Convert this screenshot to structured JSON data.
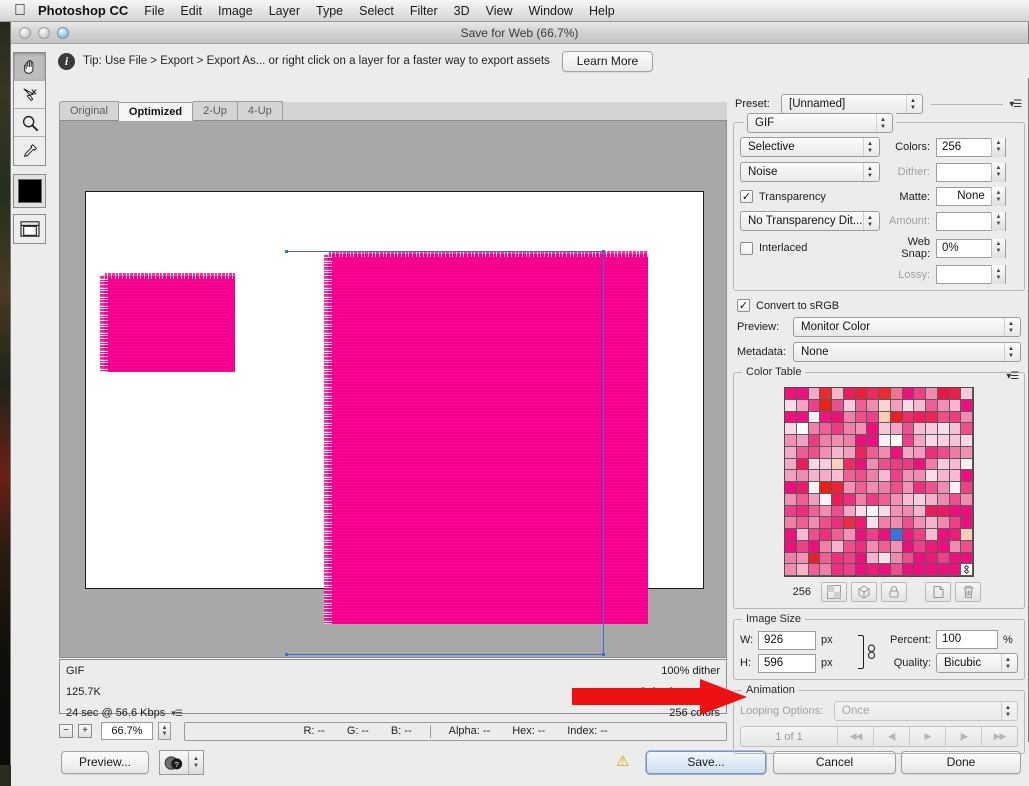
{
  "menubar": {
    "apple_icon": "apple-logo",
    "app_name": "Photoshop CC",
    "items": [
      "File",
      "Edit",
      "Image",
      "Layer",
      "Type",
      "Select",
      "Filter",
      "3D",
      "View",
      "Window",
      "Help"
    ]
  },
  "window": {
    "title": "Save for Web (66.7%)"
  },
  "tip": {
    "icon": "info-icon",
    "text": "Tip: Use File > Export > Export As...  or right click on a layer for a faster way to export assets",
    "learn_more": "Learn More"
  },
  "toolbox": {
    "tools": [
      {
        "name": "hand-tool",
        "glyph": "✋"
      },
      {
        "name": "slice-select-tool",
        "glyph": "↖"
      },
      {
        "name": "zoom-tool",
        "glyph": "🔍"
      },
      {
        "name": "eyedropper-tool",
        "glyph": "✒"
      }
    ],
    "foreground_color": "#000000",
    "toggle_slices_name": "toggle-slices-visibility"
  },
  "tabs": [
    {
      "label": "Original",
      "active": false
    },
    {
      "label": "Optimized",
      "active": true
    },
    {
      "label": "2-Up",
      "active": false
    },
    {
      "label": "4-Up",
      "active": false
    }
  ],
  "canvas": {
    "background": "#a8a8a8",
    "sheet_color": "#ffffff",
    "art_color": "#f4008c",
    "guide_color": "#3a6fd8"
  },
  "optimized_info": {
    "format": "GIF",
    "dither": "100% dither",
    "filesize": "125.7K",
    "palette": "Selective palette",
    "download": "24 sec @ 56.6 Kbps",
    "colors": "256 colors",
    "flyout_icon": "flyout-menu-icon"
  },
  "statusbar": {
    "zoom_out": "−",
    "zoom_in": "+",
    "zoom_value": "66.7%",
    "readout": {
      "r": "R: --",
      "g": "G: --",
      "b": "B: --",
      "alpha": "Alpha: --",
      "hex": "Hex: --",
      "index": "Index: --"
    }
  },
  "footer": {
    "preview": "Preview...",
    "browser_icon": "browser-question-icon",
    "warning_icon": "warning-icon",
    "save": "Save...",
    "cancel": "Cancel",
    "done": "Done"
  },
  "settings": {
    "preset_label": "Preset:",
    "preset_value": "[Unnamed]",
    "preset_flyout": "flyout-menu-icon",
    "format_value": "GIF",
    "reduction_value": "Selective",
    "colors_label": "Colors:",
    "colors_value": "256",
    "dither_algo_value": "Noise",
    "dither_label": "Dither:",
    "dither_value": "",
    "transparency_label": "Transparency",
    "transparency_checked": true,
    "matte_label": "Matte:",
    "matte_value": "None",
    "transparency_dither_value": "No Transparency Dit...",
    "amount_label": "Amount:",
    "amount_value": "",
    "interlaced_label": "Interlaced",
    "interlaced_checked": false,
    "web_snap_label": "Web Snap:",
    "web_snap_value": "0%",
    "lossy_label": "Lossy:",
    "lossy_value": "",
    "convert_srgb_label": "Convert to sRGB",
    "convert_srgb_checked": true,
    "preview_label": "Preview:",
    "preview_value": "Monitor Color",
    "metadata_label": "Metadata:",
    "metadata_value": "None"
  },
  "color_table": {
    "title": "Color Table",
    "flyout_icon": "flyout-menu-icon",
    "count": "256",
    "buttons": [
      {
        "name": "transparency-swatch-button",
        "glyph": "⬚"
      },
      {
        "name": "web-shift-button",
        "glyph": "⬡"
      },
      {
        "name": "lock-color-button",
        "glyph": "🔒"
      },
      {
        "name": "new-color-button",
        "glyph": "⬜"
      },
      {
        "name": "delete-color-button",
        "glyph": "🗑"
      }
    ],
    "swatches": [
      "#f0107e",
      "#ef0f7f",
      "#f6a8c6",
      "#ec2a2f",
      "#f7b4cb",
      "#ef1a5b",
      "#ee1d39",
      "#f02960",
      "#ee2b30",
      "#f1748e",
      "#ee1080",
      "#ef3f86",
      "#f288ad",
      "#ed1443",
      "#ee1c4c",
      "#fbc9dd",
      "#fadbe8",
      "#f5a2c3",
      "#e93f8c",
      "#eb2316",
      "#e94e8e",
      "#f9cade",
      "#ef5f94",
      "#f08bb0",
      "#fbd3cf",
      "#f39cbd",
      "#fad9e7",
      "#f6b9d2",
      "#ef5d96",
      "#f38fb4",
      "#f7b5d0",
      "#ee0f7e",
      "#ef0f80",
      "#ee1081",
      "#fdf1f5",
      "#ef1483",
      "#ee1170",
      "#f07fa8",
      "#ee4f8f",
      "#ee3f88",
      "#fbcdb9",
      "#eb1f23",
      "#ef2c68",
      "#ef1a60",
      "#ee2553",
      "#ef4e88",
      "#ee3b7f",
      "#f18bb1",
      "#fad7e7",
      "#ffffff",
      "#ef7fa4",
      "#ef5e97",
      "#ee3b83",
      "#f17fa8",
      "#f291b6",
      "#ee0f7d",
      "#f9c5da",
      "#f2a5c5",
      "#ef4f8d",
      "#f6bdd5",
      "#f9c9de",
      "#fadbe8",
      "#f7c0d6",
      "#ef4d8d",
      "#f28fb3",
      "#f2a0c1",
      "#ee3b83",
      "#f07fa8",
      "#f18dae",
      "#f07ea7",
      "#ee0f7e",
      "#ee1080",
      "#fdf2f6",
      "#fdfbf8",
      "#ef3f88",
      "#f4a4c4",
      "#fad6e6",
      "#f9cfe1",
      "#f7c3d8",
      "#fbd6e5",
      "#f5a9c8",
      "#ef5c95",
      "#ef4d8d",
      "#f28fb3",
      "#f5b3cd",
      "#f39fc0",
      "#ec2656",
      "#ef5b93",
      "#f18cb0",
      "#ee0e7c",
      "#f4a5c5",
      "#f499bd",
      "#ee2d7f",
      "#ef4a8b",
      "#f07aa4",
      "#f18fb3",
      "#f4a8c7",
      "#ee1a57",
      "#fbd8e6",
      "#f9cddf",
      "#fbd0bd",
      "#ee2a60",
      "#ee0f7e",
      "#f18cb1",
      "#ef4f8f",
      "#ee3c84",
      "#ef3a82",
      "#ee0f7e",
      "#f07ca6",
      "#f9cbdd",
      "#f6b9d2",
      "#fcefef",
      "#f3a1c1",
      "#f08ab0",
      "#f5b4cd",
      "#f4aac8",
      "#f7bdd4",
      "#ef5f96",
      "#ef4e8e",
      "#f07fa8",
      "#f7b9d1",
      "#ef3f88",
      "#f291b5",
      "#f28cb0",
      "#fbdbe8",
      "#f5b3cd",
      "#f6bad2",
      "#ee0f7e",
      "#ee0f7e",
      "#ec1a6a",
      "#fdf6f8",
      "#ec2014",
      "#ed1f3a",
      "#f28fb3",
      "#ef5f96",
      "#f18cb0",
      "#f07fa8",
      "#ef4e8e",
      "#f291b5",
      "#ee2f7f",
      "#ef5190",
      "#f08bb0",
      "#fdf3f6",
      "#ef3f88",
      "#f18fb3",
      "#ef5f96",
      "#f29cbf",
      "#fdf1f5",
      "#ec1a5b",
      "#ee2d7f",
      "#f07fa8",
      "#ee3b83",
      "#ef5f96",
      "#f291b5",
      "#f6bdd5",
      "#f9cee0",
      "#f5b1cb",
      "#f08bb0",
      "#ef4d8d",
      "#f18cb1",
      "#ef3f88",
      "#ee2d7f",
      "#ef5f96",
      "#f18cb0",
      "#ef4e8e",
      "#f4a8c7",
      "#fadfeb",
      "#fdf6f9",
      "#fbdbe8",
      "#f291b5",
      "#f08bb0",
      "#f5b3cd",
      "#ee1a5c",
      "#ec1766",
      "#ee0f7e",
      "#ee0f7e",
      "#f07fa8",
      "#ef5f96",
      "#f18cb0",
      "#ef4d8d",
      "#ee2d7f",
      "#ec2b42",
      "#ee1c74",
      "#fbe0eb",
      "#f07fa8",
      "#f18cb1",
      "#ef4e8e",
      "#f291b5",
      "#f5b3cd",
      "#f08bb0",
      "#ef3f88",
      "#ee0f7e",
      "#ee0f7e",
      "#f6b9d2",
      "#ef4d8d",
      "#ee2d7f",
      "#ef5f96",
      "#f291b5",
      "#ee0f7e",
      "#ef3f88",
      "#ee0f7e",
      "#3a74d8",
      "#ee1a7b",
      "#ef3d86",
      "#f6b9d2",
      "#ee0f7e",
      "#ee1b7c",
      "#fbcdb9",
      "#ee0f7e",
      "#ef3f88",
      "#ee0f7e",
      "#f07fa8",
      "#f5b3cd",
      "#ef4d8d",
      "#ee2d7f",
      "#f18cb0",
      "#ef5f96",
      "#f291b5",
      "#ee0f7e",
      "#ef3f88",
      "#ee1a7b",
      "#ee0f7e",
      "#f08bb0",
      "#ef4d8d",
      "#f07fa8",
      "#f291b5",
      "#e91f2b",
      "#ef5f96",
      "#ee2d7f",
      "#ef3f88",
      "#ee0f7e",
      "#f5b3cd",
      "#fadfeb",
      "#f08bb0",
      "#ef4d8d",
      "#ee0f7e",
      "#ee1a7b",
      "#ef3f88",
      "#ee0f7e",
      "#ee0f7e",
      "#f18cb0",
      "#f5b3cd",
      "#ef5f96",
      "#f07fa8",
      "#ee2d7f",
      "#ef3f88",
      "#ee0f7e",
      "#ee1a7b",
      "#ee0f7e",
      "#ef4d8d",
      "#ee0f7e",
      "#ee0f7e",
      "#ee0f7e",
      "#ee0f7e",
      "#ee0f7e",
      "#ffffff"
    ]
  },
  "image_size": {
    "title": "Image Size",
    "w_label": "W:",
    "w_value": "926",
    "w_unit": "px",
    "h_label": "H:",
    "h_value": "596",
    "h_unit": "px",
    "link_icon": "link-chain-icon",
    "percent_label": "Percent:",
    "percent_value": "100",
    "percent_unit": "%",
    "quality_label": "Quality:",
    "quality_value": "Bicubic"
  },
  "animation": {
    "title": "Animation",
    "looping_label": "Looping Options:",
    "looping_value": "Once",
    "frame_count": "1 of 1",
    "nav_buttons": [
      {
        "name": "first-frame-button",
        "glyph": "◀◀"
      },
      {
        "name": "previous-frame-button",
        "glyph": "◀|"
      },
      {
        "name": "play-button",
        "glyph": "▶"
      },
      {
        "name": "next-frame-button",
        "glyph": "|▶"
      },
      {
        "name": "last-frame-button",
        "glyph": "▶▶"
      }
    ]
  },
  "annotation": {
    "arrow_color": "#ee1111",
    "arrow_name": "red-annotation-arrow"
  }
}
